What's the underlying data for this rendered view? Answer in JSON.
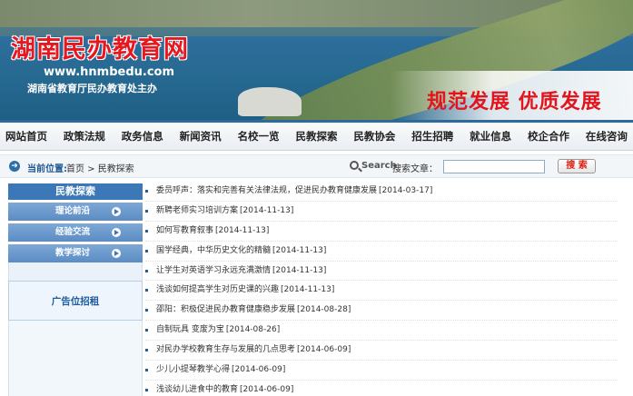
{
  "header": {
    "site_title": "湖南民办教育网",
    "site_url": "www.hnmbedu.com",
    "department": "湖南省教育厅民办教育处主办",
    "slogan": "规范发展  优质发展"
  },
  "nav": {
    "items": [
      "网站首页",
      "政策法规",
      "政务信息",
      "新闻资讯",
      "名校一览",
      "民教探索",
      "民教协会",
      "招生招聘",
      "就业信息",
      "校企合作",
      "在线咨询"
    ]
  },
  "breadcrumb": {
    "location_label": "当前位置:",
    "path": "首页 > 民教探索"
  },
  "search": {
    "icon_word": "Search",
    "label": "搜索文章：",
    "value": "",
    "button_label": "搜 索"
  },
  "sidebar": {
    "heading": "民教探索",
    "items": [
      "理论前沿",
      "经验交流",
      "教学探讨"
    ],
    "ad_text": "广告位招租"
  },
  "articles": [
    {
      "title": "委员呼声：落实和完善有关法律法规，促进民办教育健康发展",
      "date": "[2014-03-17]"
    },
    {
      "title": "新聘老师实习培训方案",
      "date": "[2014-11-13]"
    },
    {
      "title": "如何写教育叙事",
      "date": "[2014-11-13]"
    },
    {
      "title": "国学经典，中华历史文化的精髓",
      "date": "[2014-11-13]"
    },
    {
      "title": "让学生对英语学习永远充满激情",
      "date": "[2014-11-13]"
    },
    {
      "title": "浅谈如何提高学生对历史课的兴趣",
      "date": "[2014-11-13]"
    },
    {
      "title": "邵阳：积极促进民办教育健康稳步发展",
      "date": "[2014-08-28]"
    },
    {
      "title": "自制玩具  变废为宝",
      "date": "[2014-08-26]"
    },
    {
      "title": "对民办学校教育生存与发展的几点思考",
      "date": "[2014-06-09]"
    },
    {
      "title": "少儿小提琴教学心得",
      "date": "[2014-06-09]"
    },
    {
      "title": "浅谈幼儿进食中的教育",
      "date": "[2014-06-09]"
    }
  ]
}
